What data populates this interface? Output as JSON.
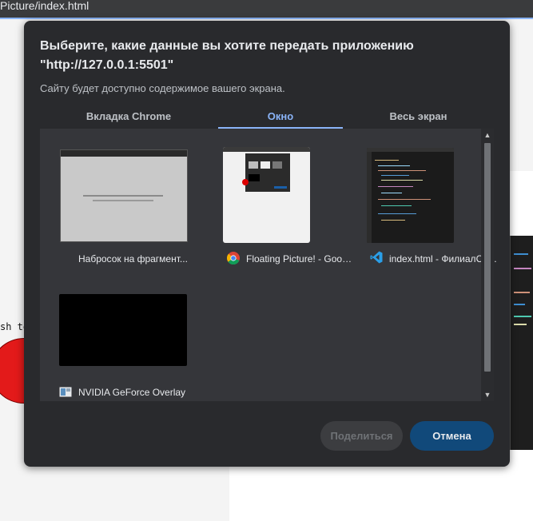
{
  "browser": {
    "url_fragment": "Picture/index.html"
  },
  "background": {
    "partial_text": "sh te"
  },
  "dialog": {
    "title": "Выберите, какие данные вы хотите передать приложению \"http://127.0.0.1:5501\"",
    "subtitle": "Сайту будет доступно содержимое вашего экрана.",
    "tabs": [
      {
        "label": "Вкладка Chrome",
        "active": false
      },
      {
        "label": "Окно",
        "active": true
      },
      {
        "label": "Весь экран",
        "active": false
      }
    ],
    "windows": [
      {
        "label": "Набросок на фрагмент...",
        "icon": "snip-sketch-icon"
      },
      {
        "label": "Floating Picture! - Goog...",
        "icon": "chrome-icon"
      },
      {
        "label": "index.html - ФилиалСХ...",
        "icon": "vscode-icon"
      },
      {
        "label": "NVIDIA GeForce Overlay",
        "icon": "nvidia-overlay-icon"
      }
    ],
    "buttons": {
      "share": "Поделиться",
      "cancel": "Отмена"
    }
  },
  "colors": {
    "accent": "#8ab4f8",
    "dialog_bg": "#292a2d",
    "cancel_bg": "#11497a"
  }
}
